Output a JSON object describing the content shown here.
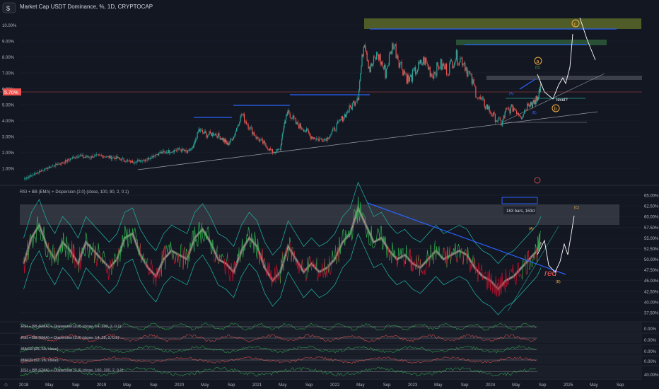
{
  "header": {
    "symbol_box": "$",
    "title": "Market Cap USDT Dominance, %, 1D, CRYPTOCAP"
  },
  "colors": {
    "background": "#131722",
    "up": "#26a69a",
    "down": "#ef5350",
    "trendline": "#2962ff",
    "annotation_orange": "#f5b041",
    "annotation_green": "#4caf50",
    "zone_olive": "#6b7a2a",
    "zone_green": "#2e5b3a",
    "rsi_green": "#2fb24f",
    "rsi_red": "#c8102e",
    "bb_teal": "#1fa69a"
  },
  "chart_data": [
    {
      "type": "line",
      "title": "Market Cap USDT Dominance, %, 1D, CRYPTOCAP",
      "price_scale": [
        "10.00%",
        "9.00%",
        "8.00%",
        "7.00%",
        "6.00%",
        "5.00%",
        "4.00%",
        "3.00%",
        "2.00%",
        "1.00%"
      ],
      "price_ticks": [
        10,
        9,
        8,
        7,
        6,
        5,
        4,
        3,
        2,
        1
      ],
      "current_price_label": "5.70%",
      "current_price": 5.7,
      "ylim": [
        0.2,
        10.6
      ],
      "x_labels": [
        "2018",
        "May",
        "Sep",
        "2019",
        "May",
        "Sep",
        "2020",
        "May",
        "Sep",
        "2021",
        "May",
        "Sep",
        "2022",
        "May",
        "Sep",
        "2023",
        "May",
        "Sep",
        "2024",
        "May",
        "Sep",
        "2025",
        "May",
        "Sep"
      ],
      "x_ticks": [
        2018.0,
        2018.33,
        2018.67,
        2019.0,
        2019.33,
        2019.67,
        2020.0,
        2020.33,
        2020.67,
        2021.0,
        2021.33,
        2021.67,
        2022.0,
        2022.33,
        2022.67,
        2023.0,
        2023.33,
        2023.67,
        2024.0,
        2024.33,
        2024.67,
        2025.0,
        2025.33,
        2025.67
      ],
      "xlim": [
        2017.95,
        2025.95
      ],
      "series": [
        {
          "x": [
            2018.0,
            2018.1,
            2018.2,
            2018.3,
            2018.4,
            2018.5,
            2018.6,
            2018.7,
            2018.8,
            2018.9,
            2019.0,
            2019.1,
            2019.2,
            2019.3,
            2019.4,
            2019.5,
            2019.6,
            2019.7,
            2019.8,
            2019.9,
            2020.0,
            2020.1,
            2020.18,
            2020.25,
            2020.35,
            2020.45,
            2020.55,
            2020.62,
            2020.7,
            2020.8,
            2020.9,
            2021.0,
            2021.1,
            2021.2,
            2021.3,
            2021.35,
            2021.4,
            2021.5,
            2021.6,
            2021.7,
            2021.8,
            2021.9,
            2022.0,
            2022.1,
            2022.2,
            2022.3,
            2022.38,
            2022.45,
            2022.55,
            2022.65,
            2022.75,
            2022.85,
            2022.95,
            2023.05,
            2023.15,
            2023.25,
            2023.35,
            2023.45,
            2023.55,
            2023.65,
            2023.75,
            2023.85,
            2023.95,
            2024.05,
            2024.15,
            2024.2,
            2024.3,
            2024.4,
            2024.5,
            2024.55,
            2024.6,
            2024.65
          ],
          "values": [
            0.35,
            0.55,
            0.8,
            1.0,
            1.2,
            1.35,
            1.6,
            1.8,
            1.7,
            1.75,
            1.8,
            1.7,
            1.65,
            1.5,
            1.4,
            1.5,
            1.6,
            1.9,
            2.0,
            2.1,
            2.2,
            2.0,
            2.3,
            3.4,
            3.1,
            3.2,
            2.9,
            2.5,
            3.0,
            4.4,
            3.6,
            2.9,
            2.5,
            2.0,
            2.2,
            3.8,
            4.6,
            3.8,
            3.5,
            3.0,
            2.8,
            2.9,
            3.5,
            4.2,
            4.8,
            5.6,
            9.2,
            7.2,
            8.2,
            7.0,
            8.9,
            7.5,
            6.5,
            7.2,
            7.8,
            6.9,
            7.5,
            7.2,
            8.0,
            7.8,
            6.6,
            5.4,
            4.9,
            4.2,
            3.8,
            4.6,
            4.8,
            4.3,
            5.2,
            5.0,
            5.4,
            6.2
          ]
        }
      ],
      "annotations": [
        {
          "text": "c",
          "kind": "circle-orange"
        },
        {
          "text": "a",
          "kind": "circle-orange"
        },
        {
          "text": "(C)",
          "kind": "green"
        },
        {
          "text": "(A)",
          "kind": "blue"
        },
        {
          "text": "(B)",
          "kind": "blue"
        },
        {
          "text": "b",
          "kind": "circle-orange"
        },
        {
          "text": "level?",
          "kind": "white"
        }
      ]
    },
    {
      "type": "line",
      "title": "RSI + BB (EMA) + Dispersion (2.0) (close, 100, 80, 2, 0.1)",
      "price_scale": [
        "65.00%",
        "62.50%",
        "60.00%",
        "57.50%",
        "55.00%",
        "52.50%",
        "50.00%",
        "47.50%",
        "45.00%",
        "42.50%",
        "40.00%",
        "37.50%"
      ],
      "price_ticks": [
        65,
        62.5,
        60,
        57.5,
        55,
        52.5,
        50,
        47.5,
        45,
        42.5,
        40,
        37.5
      ],
      "ylim": [
        36.5,
        66.0
      ],
      "series": [
        {
          "name": "RSI",
          "x": [
            2018.0,
            2018.1,
            2018.2,
            2018.3,
            2018.4,
            2018.5,
            2018.6,
            2018.7,
            2018.8,
            2018.9,
            2019.0,
            2019.1,
            2019.2,
            2019.3,
            2019.4,
            2019.5,
            2019.6,
            2019.7,
            2019.8,
            2019.9,
            2020.0,
            2020.1,
            2020.2,
            2020.3,
            2020.4,
            2020.5,
            2020.6,
            2020.7,
            2020.8,
            2020.9,
            2021.0,
            2021.1,
            2021.2,
            2021.3,
            2021.4,
            2021.5,
            2021.6,
            2021.7,
            2021.8,
            2021.9,
            2022.0,
            2022.1,
            2022.2,
            2022.3,
            2022.4,
            2022.5,
            2022.6,
            2022.7,
            2022.8,
            2022.9,
            2023.0,
            2023.1,
            2023.2,
            2023.3,
            2023.4,
            2023.5,
            2023.6,
            2023.7,
            2023.8,
            2023.9,
            2024.0,
            2024.1,
            2024.2,
            2024.3,
            2024.4,
            2024.5,
            2024.6,
            2024.65
          ],
          "values": [
            49.0,
            55.0,
            58.0,
            53.0,
            50.0,
            54.0,
            52.0,
            49.0,
            54.0,
            52.0,
            50.0,
            48.0,
            50.0,
            55.0,
            56.0,
            51.0,
            48.0,
            46.0,
            50.0,
            52.0,
            51.0,
            50.0,
            55.0,
            57.0,
            54.0,
            50.0,
            49.0,
            47.0,
            52.0,
            55.0,
            53.0,
            48.0,
            45.0,
            47.0,
            53.0,
            50.0,
            47.0,
            49.0,
            47.0,
            48.0,
            50.0,
            54.0,
            56.0,
            62.0,
            58.0,
            54.0,
            55.0,
            52.0,
            50.0,
            51.0,
            49.0,
            48.0,
            50.0,
            52.0,
            50.0,
            51.0,
            52.0,
            51.0,
            48.0,
            46.0,
            45.0,
            43.0,
            45.0,
            46.0,
            48.0,
            50.0,
            52.0,
            54.0
          ]
        }
      ],
      "annotations": [
        {
          "text": "163 bars, 163d",
          "kind": "range-label"
        },
        {
          "text": "(C)",
          "kind": "orange"
        },
        {
          "text": "(A)",
          "kind": "orange"
        },
        {
          "text": "(B)",
          "kind": "orange"
        },
        {
          "text": "red",
          "kind": "handwritten-red"
        }
      ]
    }
  ],
  "sub_panes": [
    {
      "title": "RSI + BB (EMA) + Dispersion (2.0) (close, 14, 100, 2, 0.1)"
    },
    {
      "title": "RSI + BB (EMA) + Dispersion (2.0) (close, 14, 28, 2, 0.1)"
    },
    {
      "title": "MACD (25, 50, close)"
    },
    {
      "title": "MACD (12, 26, close)"
    },
    {
      "title": "RSI + BB (EMA) + Dispersion (2.0) (close, 100, 100, 2, 0.1)"
    }
  ],
  "sub_scale": [
    "0.00%",
    "0.00%",
    "0.00%",
    "0.00%",
    "40.00%"
  ]
}
